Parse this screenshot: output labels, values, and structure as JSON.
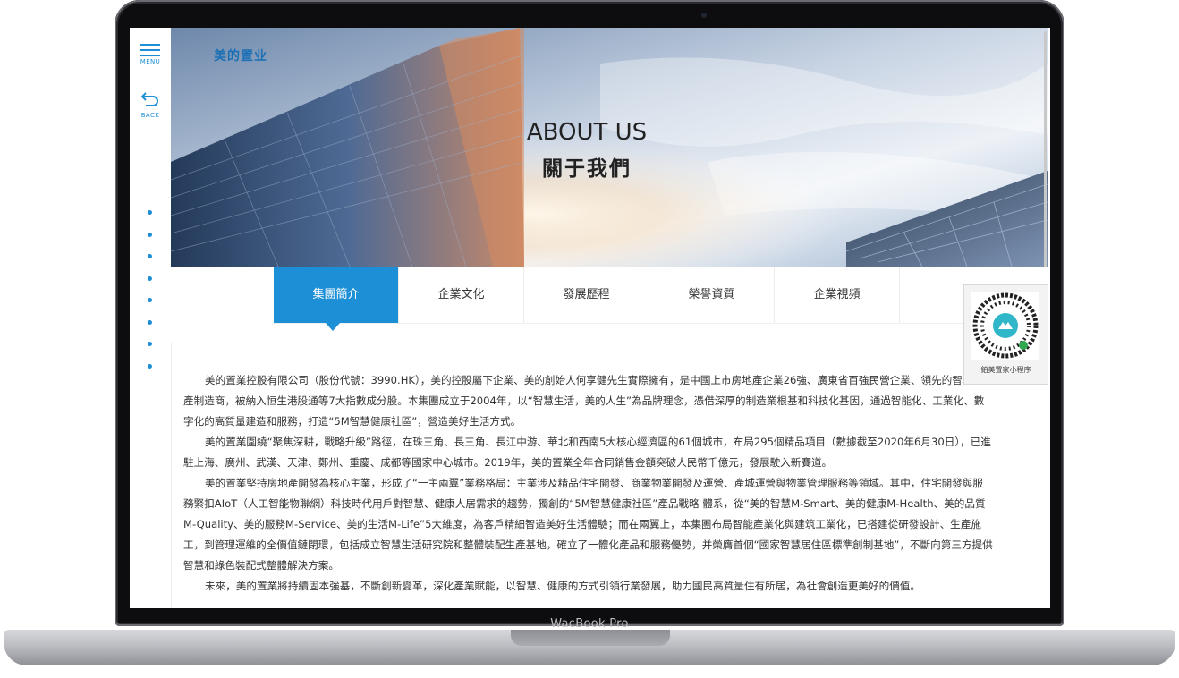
{
  "device": {
    "label": "WacBook Pro"
  },
  "sidebar": {
    "menu_label": "MENU",
    "back_label": "BACK",
    "dot_count": 8
  },
  "brand": {
    "logo_text": "美的置业",
    "accent_color": "#1d8fd6"
  },
  "banner": {
    "title_en": "ABOUT US",
    "title_zh": "關于我們"
  },
  "tabs": [
    {
      "label": "集團簡介",
      "active": true
    },
    {
      "label": "企業文化",
      "active": false
    },
    {
      "label": "發展歷程",
      "active": false
    },
    {
      "label": "榮譽資質",
      "active": false
    },
    {
      "label": "企業視頻",
      "active": false
    }
  ],
  "qr": {
    "caption": "鉑美置家小程序"
  },
  "content": {
    "paragraphs": [
      "美的置業控股有限公司（股份代號：3990.HK），美的控股屬下企業、美的創始人何享健先生實際擁有，是中國上市房地產企業26強、廣東省百強民營企業、領先的智慧地產制造商，被納入恒生港股通等7大指數成分股。本集團成立于2004年，以“智慧生活，美的人生”為品牌理念，憑借深厚的制造業根基和科技化基因，通過智能化、工業化、數字化的高質量建造和服務，打造“5M智慧健康社區”，營造美好生活方式。",
      "美的置業圍繞“聚焦深耕，戰略升級”路徑，在珠三角、長三角、長江中游、華北和西南5大核心經濟區的61個城市，布局295個精品項目（數據截至2020年6月30日），已進駐上海、廣州、武漢、天津、鄭州、重慶、成都等國家中心城市。2019年，美的置業全年合同銷售金額突破人民幣千億元，發展駛入新賽道。",
      "美的置業堅持房地產開發為核心主業，形成了“一主兩翼”業務格局：主業涉及精品住宅開發、商業物業開發及運營、產城運營與物業管理服務等領域。其中，住宅開發與服務緊扣AIoT（人工智能物聯網）科技時代用戶對智慧、健康人居需求的趨勢，獨創的“5M智慧健康社區”產品戰略 體系，從“美的智慧M-Smart、美的健康M-Health、美的品質M-Quality、美的服務M-Service、美的生活M-Life”5大維度，為客戶精細智造美好生活體驗；而在兩翼上，本集團布局智能產業化與建筑工業化，已搭建從研發設計、生產施工，到管理運維的全價值鏈閉環，包括成立智慧生活研究院和整體裝配生產基地，確立了一體化產品和服務優勢，并榮膺首個“國家智慧居住區標準創制基地”，不斷向第三方提供智慧和綠色裝配式整體解決方案。",
      "未來，美的置業將持續固本強基，不斷創新變革，深化產業賦能，以智慧、健康的方式引領行業發展，助力國民高質量住有所居，為社會創造更美好的價值。"
    ]
  }
}
